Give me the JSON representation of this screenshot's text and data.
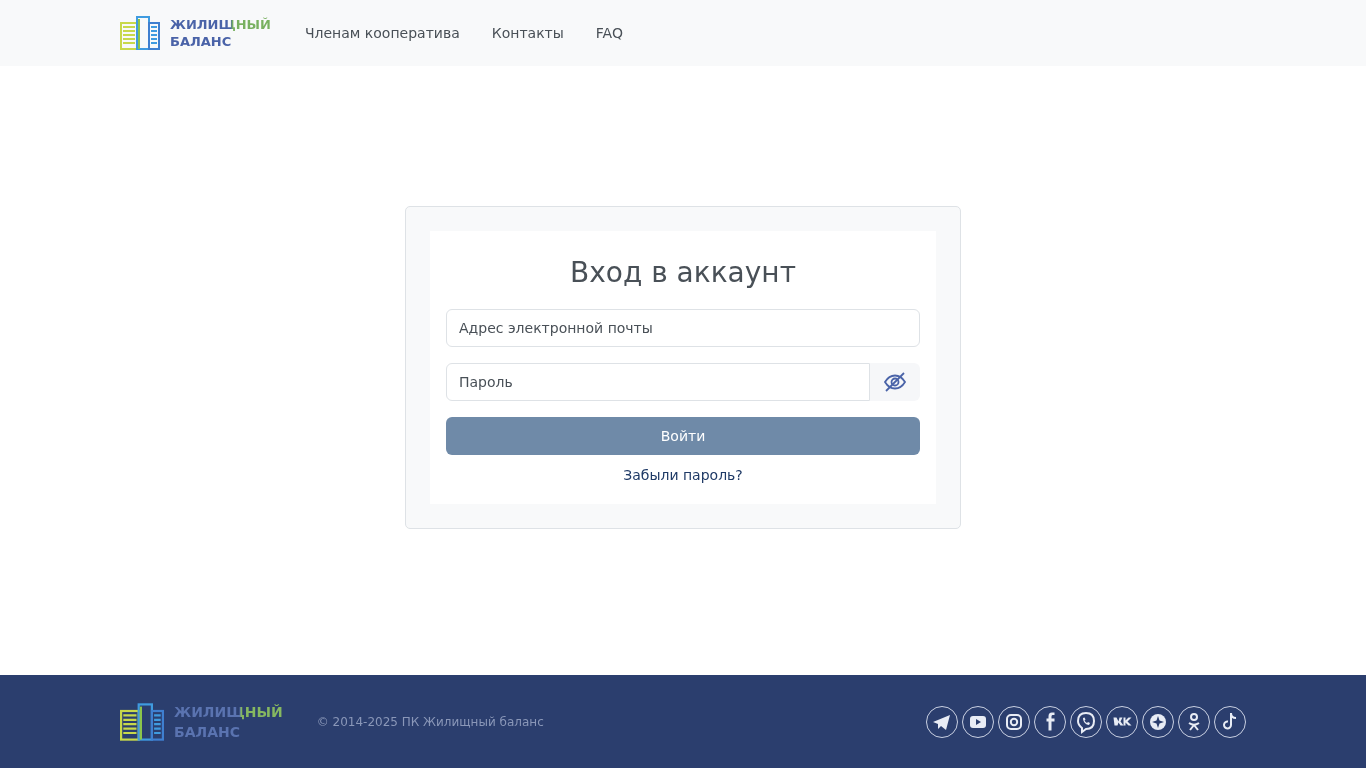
{
  "header": {
    "logo": {
      "line1": "ЖИЛИЩНЫЙ",
      "line2": "БАЛАНС"
    },
    "nav": [
      {
        "label": "Членам кооператива"
      },
      {
        "label": "Контакты"
      },
      {
        "label": "FAQ"
      }
    ]
  },
  "login": {
    "title": "Вход в аккаунт",
    "email": {
      "placeholder": "Адрес электронной почты"
    },
    "password": {
      "placeholder": "Пароль"
    },
    "submit": "Войти",
    "forgot": "Забыли пароль?"
  },
  "footer": {
    "logo": {
      "line1": "ЖИЛИЩНЫЙ",
      "line2": "БАЛАНС"
    },
    "copyright": "© 2014-2025 ПК Жилищный баланс"
  }
}
